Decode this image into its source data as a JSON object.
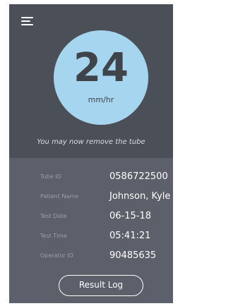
{
  "header": {
    "menu_icon": "hamburger-menu-icon"
  },
  "result": {
    "value": "24",
    "unit": "mm/hr"
  },
  "message": "You may now remove the tube",
  "details": [
    {
      "label": "Tube ID",
      "value": "0586722500"
    },
    {
      "label": "Patient Name",
      "value": "Johnson, Kyle"
    },
    {
      "label": "Test Date",
      "value": "06-15-18"
    },
    {
      "label": "Test Time",
      "value": "05:41:21"
    },
    {
      "label": "Operator ID",
      "value": "90485635"
    }
  ],
  "actions": {
    "result_log_label": "Result Log"
  },
  "colors": {
    "top_panel": "#4a4f58",
    "bottom_panel": "#5b606a",
    "result_circle": "#a6d5f0"
  }
}
